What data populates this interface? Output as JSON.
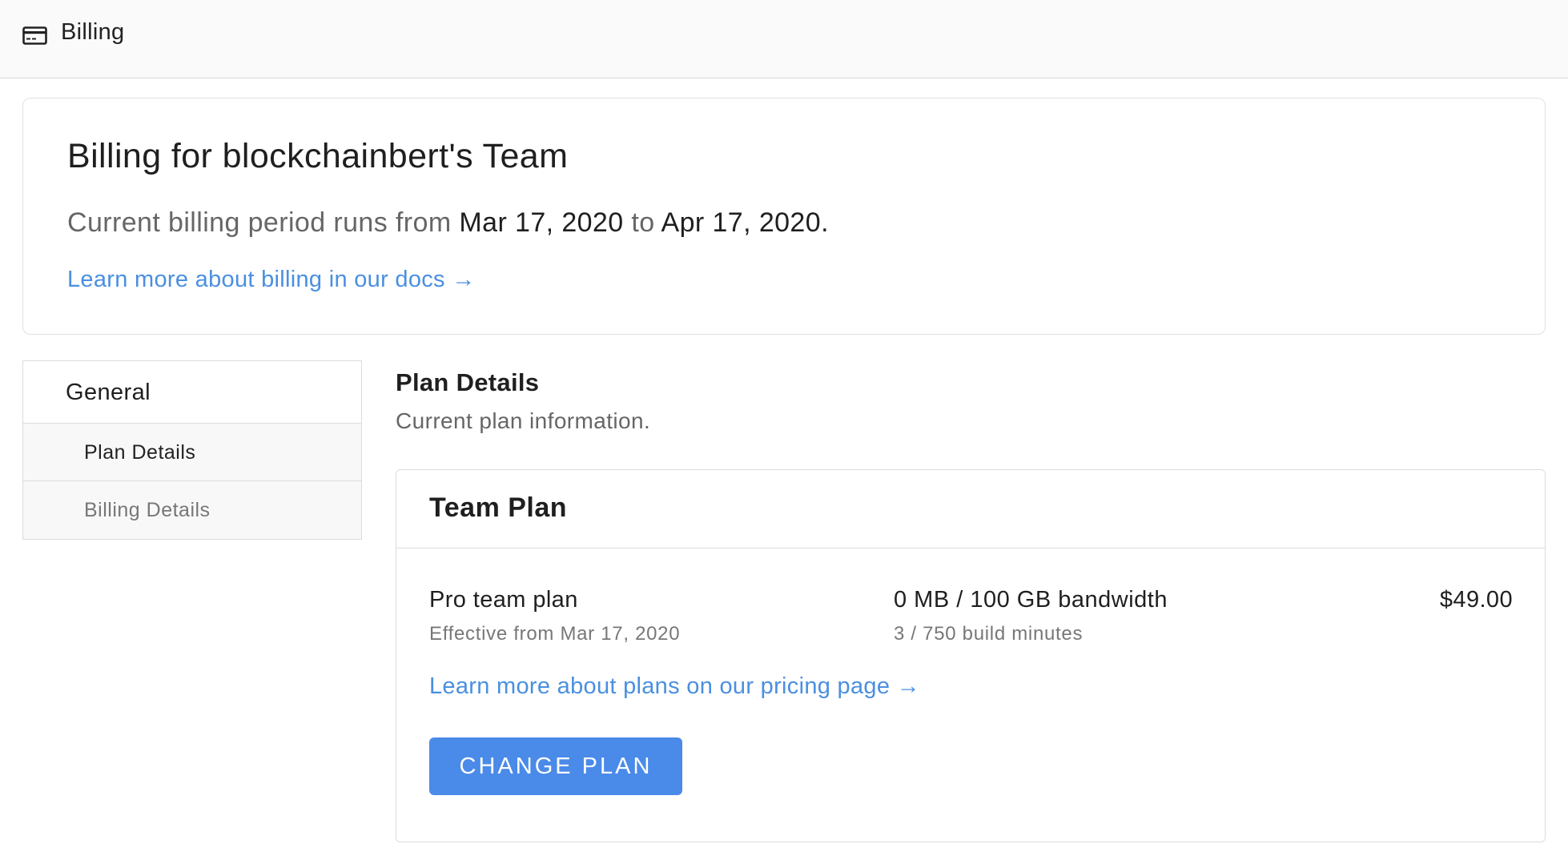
{
  "topbar": {
    "icon": "credit-card-icon",
    "title": "Billing"
  },
  "header": {
    "title": "Billing for blockchainbert's Team",
    "period_prefix": "Current billing period runs from ",
    "period_start": "Mar 17, 2020",
    "period_mid": " to ",
    "period_end": "Apr 17, 2020",
    "period_suffix": ".",
    "docs_link": "Learn more about billing in our docs →"
  },
  "sidenav": {
    "heading": "General",
    "items": [
      {
        "label": "Plan Details"
      },
      {
        "label": "Billing Details"
      }
    ]
  },
  "plan_section": {
    "title": "Plan Details",
    "subtitle": "Current plan information."
  },
  "plan_card": {
    "title": "Team Plan",
    "plan_name": "Pro team plan",
    "effective": "Effective from Mar 17, 2020",
    "bandwidth": "0 MB / 100 GB bandwidth",
    "build_minutes": "3 / 750 build minutes",
    "price": "$49.00",
    "pricing_link": "Learn more about plans on our pricing page →",
    "change_plan_label": "CHANGE PLAN"
  },
  "colors": {
    "accent": "#4a8ae8",
    "link": "#4a8fe0"
  }
}
